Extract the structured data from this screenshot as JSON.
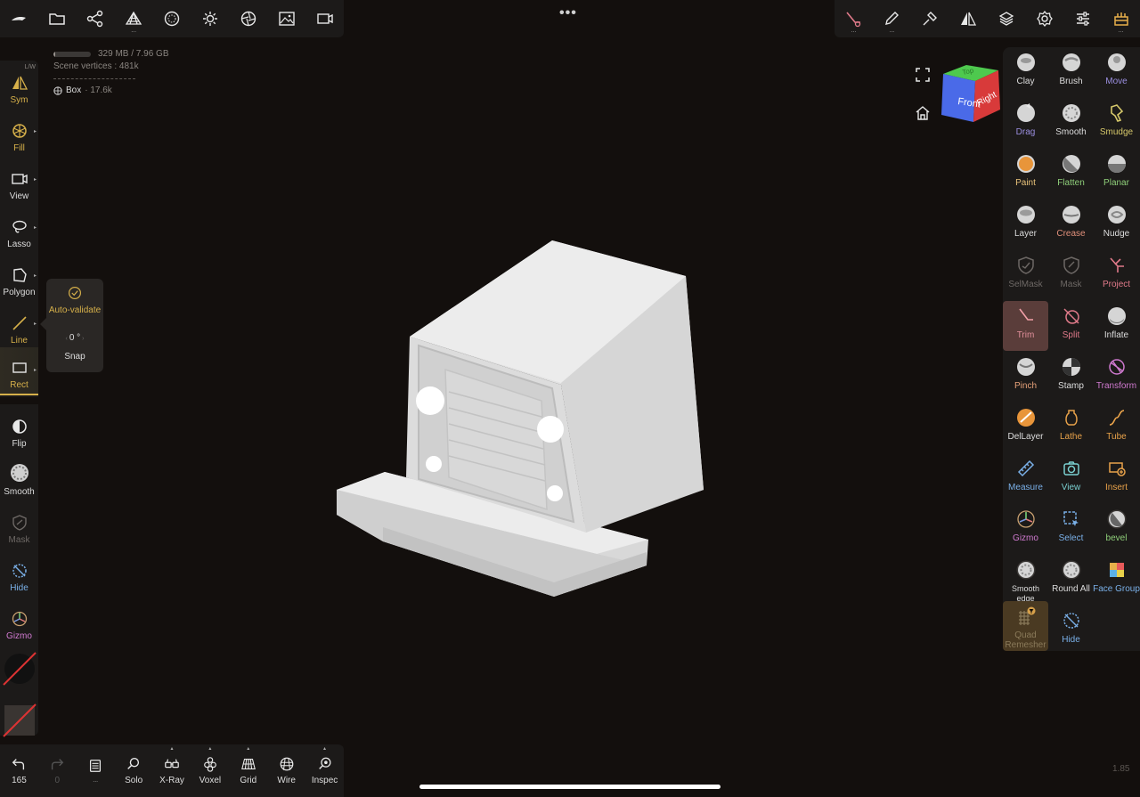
{
  "top_left_toolbar": {
    "icons": [
      "nomad-logo-icon",
      "folder-icon",
      "scene-graph-icon",
      "topology-icon",
      "material-icon",
      "light-icon",
      "shading-icon",
      "background-icon",
      "camera-icon"
    ]
  },
  "top_right_toolbar": {
    "icons": [
      "trim-tool-icon",
      "pen-icon",
      "stroke-icon",
      "symmetry-icon",
      "layers-icon",
      "settings-icon",
      "sliders-icon",
      "interface-icon"
    ]
  },
  "stats": {
    "memory": "329 MB / 7.96 GB",
    "memory_fraction": 0.04,
    "vertices": "Scene vertices : 481k",
    "object_name": "Box",
    "object_count": "· 17.6k"
  },
  "left_tools": {
    "sym_badge": "L/W",
    "sym": "Sym",
    "fill": "Fill",
    "view": "View",
    "lasso": "Lasso",
    "polygon": "Polygon",
    "line": "Line",
    "rect": "Rect",
    "flip": "Flip",
    "smooth": "Smooth",
    "mask": "Mask",
    "hide": "Hide",
    "gizmo": "Gizmo"
  },
  "popover": {
    "auto_validate": "Auto-validate",
    "angle": "0 °",
    "snap": "Snap"
  },
  "cube": {
    "front": "Front",
    "right": "Right",
    "top": "Top"
  },
  "tools": [
    {
      "label": "Clay",
      "color": "#dddddd"
    },
    {
      "label": "Brush",
      "color": "#dddddd"
    },
    {
      "label": "Move",
      "color": "#9b8fe0"
    },
    {
      "label": "Drag",
      "color": "#9b8fe0"
    },
    {
      "label": "Smooth",
      "color": "#dddddd"
    },
    {
      "label": "Smudge",
      "color": "#d6c86a"
    },
    {
      "label": "Paint",
      "color": "#e8c27a"
    },
    {
      "label": "Flatten",
      "color": "#8fcf7a"
    },
    {
      "label": "Planar",
      "color": "#8fcf7a"
    },
    {
      "label": "Layer",
      "color": "#dddddd"
    },
    {
      "label": "Crease",
      "color": "#e08f7a"
    },
    {
      "label": "Nudge",
      "color": "#dddddd"
    },
    {
      "label": "SelMask",
      "color": "#6d6865"
    },
    {
      "label": "Mask",
      "color": "#6d6865"
    },
    {
      "label": "Project",
      "color": "#e07a8a"
    },
    {
      "label": "Trim",
      "color": "#e08f9a"
    },
    {
      "label": "Split",
      "color": "#e07a8a"
    },
    {
      "label": "Inflate",
      "color": "#dddddd"
    },
    {
      "label": "Pinch",
      "color": "#e8a27a"
    },
    {
      "label": "Stamp",
      "color": "#dddddd"
    },
    {
      "label": "Transform",
      "color": "#d07ad0"
    },
    {
      "label": "DelLayer",
      "color": "#dddddd"
    },
    {
      "label": "Lathe",
      "color": "#e8a24a"
    },
    {
      "label": "Tube",
      "color": "#e8a24a"
    },
    {
      "label": "Measure",
      "color": "#7ab0e8"
    },
    {
      "label": "View",
      "color": "#7ad0d0"
    },
    {
      "label": "Insert",
      "color": "#e8a24a"
    },
    {
      "label": "Gizmo",
      "color": "#d07ad0"
    },
    {
      "label": "Select",
      "color": "#7ab0e8"
    },
    {
      "label": "bevel",
      "color": "#8fcf7a"
    },
    {
      "label": "Smooth edge",
      "color": "#dddddd"
    },
    {
      "label": "Round All",
      "color": "#dddddd"
    },
    {
      "label": "Face Group",
      "color": "#7ab0e8"
    },
    {
      "label": "Quad Remesher",
      "color": "#8a7a5a"
    },
    {
      "label": "Hide",
      "color": "#7ab0e8"
    }
  ],
  "bottom": {
    "undo_count": "165",
    "redo_count": "0",
    "layers": "...",
    "solo": "Solo",
    "xray": "X-Ray",
    "voxel": "Voxel",
    "grid": "Grid",
    "wire": "Wire",
    "inspect": "Inspec"
  },
  "version": "1.85",
  "accent": "#d6b04a"
}
